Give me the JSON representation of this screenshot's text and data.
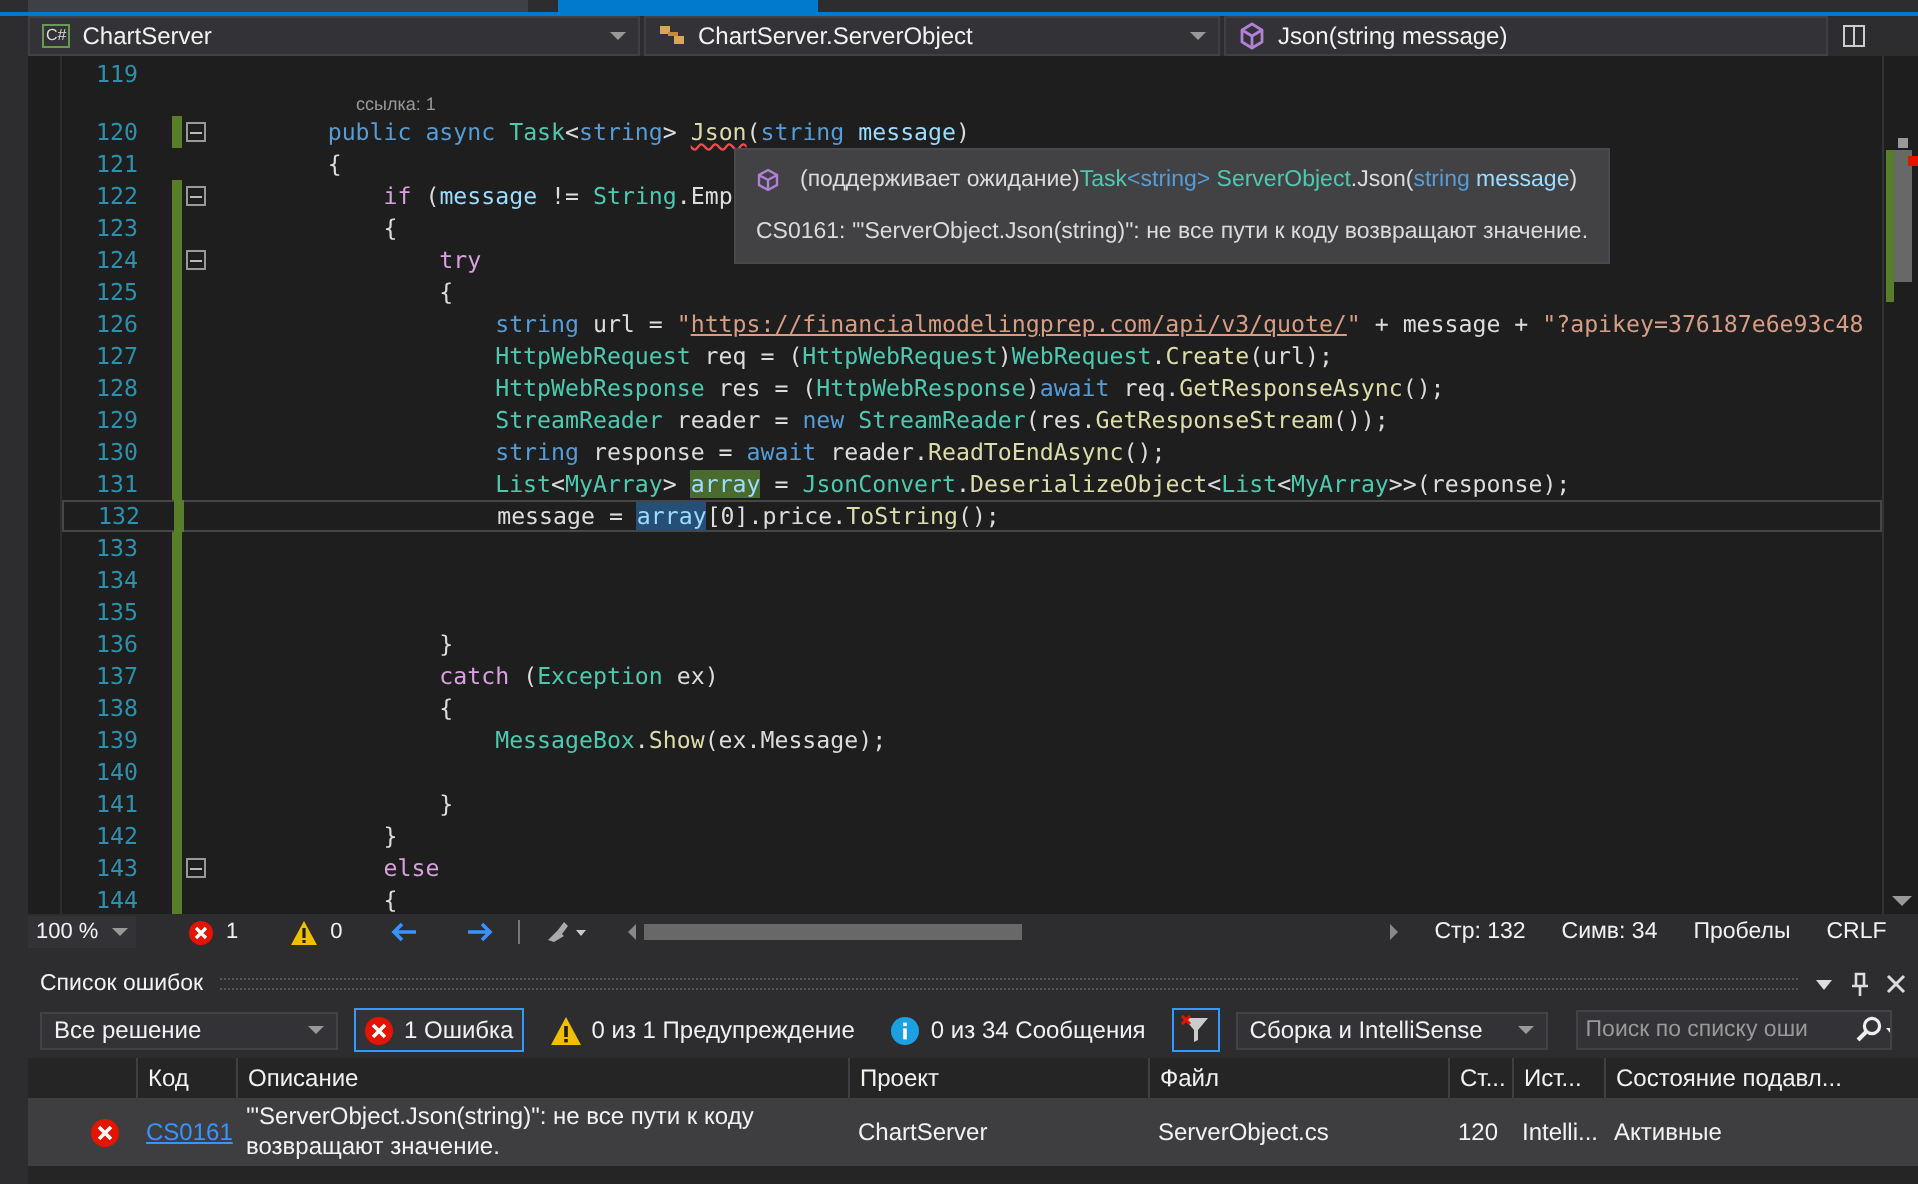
{
  "navigation": {
    "project_icon": "C#",
    "project": "ChartServer",
    "type": "ChartServer.ServerObject",
    "member": "Json(string message)"
  },
  "editor": {
    "lines": [
      {
        "kind": "code",
        "number": "119",
        "modified": false,
        "collapsible": false,
        "current": false
      },
      {
        "kind": "codelens",
        "text": "ссылка: 1"
      },
      {
        "kind": "code",
        "number": "120",
        "modified": true,
        "collapsible": true,
        "current": false,
        "tokens": [
          {
            "kind": "keyword",
            "text": "        public async "
          },
          {
            "kind": "type",
            "text": "Task"
          },
          {
            "kind": "plain",
            "text": "<"
          },
          {
            "kind": "keyword",
            "text": "string"
          },
          {
            "kind": "plain",
            "text": "> "
          },
          {
            "kind": "error-name",
            "text": "Json"
          },
          {
            "kind": "plain",
            "text": "("
          },
          {
            "kind": "keyword",
            "text": "string"
          },
          {
            "kind": "param",
            "text": " message"
          },
          {
            "kind": "plain",
            "text": ")"
          }
        ]
      },
      {
        "kind": "code",
        "number": "121",
        "modified": false,
        "collapsible": false,
        "current": false,
        "tokens": [
          {
            "kind": "plain",
            "text": "        {"
          }
        ]
      },
      {
        "kind": "code",
        "number": "122",
        "modified": true,
        "collapsible": true,
        "current": false,
        "tokens": [
          {
            "kind": "control",
            "text": "            if"
          },
          {
            "kind": "plain",
            "text": " ("
          },
          {
            "kind": "param",
            "text": "message"
          },
          {
            "kind": "plain",
            "text": " != "
          },
          {
            "kind": "type",
            "text": "String"
          },
          {
            "kind": "plain",
            "text": ".Emp"
          }
        ]
      },
      {
        "kind": "code",
        "number": "123",
        "modified": true,
        "collapsible": false,
        "current": false,
        "tokens": [
          {
            "kind": "plain",
            "text": "            {"
          }
        ]
      },
      {
        "kind": "code",
        "number": "124",
        "modified": true,
        "collapsible": true,
        "current": false,
        "tokens": [
          {
            "kind": "control",
            "text": "                try"
          }
        ]
      },
      {
        "kind": "code",
        "number": "125",
        "modified": true,
        "collapsible": false,
        "current": false,
        "tokens": [
          {
            "kind": "plain",
            "text": "                {"
          }
        ]
      },
      {
        "kind": "code",
        "number": "126",
        "modified": true,
        "collapsible": false,
        "current": false,
        "tokens": [
          {
            "kind": "keyword",
            "text": "                    string"
          },
          {
            "kind": "plain",
            "text": " url = "
          },
          {
            "kind": "string",
            "text": "\""
          },
          {
            "kind": "url",
            "text": "https://financialmodelingprep.com/api/v3/quote/"
          },
          {
            "kind": "string",
            "text": "\""
          },
          {
            "kind": "plain",
            "text": " + message + "
          },
          {
            "kind": "string",
            "text": "\"?apikey=376187e6e93c48"
          }
        ]
      },
      {
        "kind": "code",
        "number": "127",
        "modified": true,
        "collapsible": false,
        "current": false,
        "tokens": [
          {
            "kind": "type",
            "text": "                    HttpWebRequest"
          },
          {
            "kind": "plain",
            "text": " req = ("
          },
          {
            "kind": "type",
            "text": "HttpWebRequest"
          },
          {
            "kind": "plain",
            "text": ")"
          },
          {
            "kind": "type",
            "text": "WebRequest"
          },
          {
            "kind": "plain",
            "text": "."
          },
          {
            "kind": "method",
            "text": "Create"
          },
          {
            "kind": "plain",
            "text": "(url);"
          }
        ]
      },
      {
        "kind": "code",
        "number": "128",
        "modified": true,
        "collapsible": false,
        "current": false,
        "tokens": [
          {
            "kind": "type",
            "text": "                    HttpWebResponse"
          },
          {
            "kind": "plain",
            "text": " res = ("
          },
          {
            "kind": "type",
            "text": "HttpWebResponse"
          },
          {
            "kind": "plain",
            "text": ")"
          },
          {
            "kind": "keyword",
            "text": "await"
          },
          {
            "kind": "plain",
            "text": " req."
          },
          {
            "kind": "method",
            "text": "GetResponseAsync"
          },
          {
            "kind": "plain",
            "text": "();"
          }
        ]
      },
      {
        "kind": "code",
        "number": "129",
        "modified": true,
        "collapsible": false,
        "current": false,
        "tokens": [
          {
            "kind": "type",
            "text": "                    StreamReader"
          },
          {
            "kind": "plain",
            "text": " reader = "
          },
          {
            "kind": "keyword",
            "text": "new"
          },
          {
            "kind": "type",
            "text": " StreamReader"
          },
          {
            "kind": "plain",
            "text": "(res."
          },
          {
            "kind": "method",
            "text": "GetResponseStream"
          },
          {
            "kind": "plain",
            "text": "());"
          }
        ]
      },
      {
        "kind": "code",
        "number": "130",
        "modified": true,
        "collapsible": false,
        "current": false,
        "tokens": [
          {
            "kind": "keyword",
            "text": "                    string"
          },
          {
            "kind": "plain",
            "text": " response = "
          },
          {
            "kind": "keyword",
            "text": "await"
          },
          {
            "kind": "plain",
            "text": " reader."
          },
          {
            "kind": "method",
            "text": "ReadToEndAsync"
          },
          {
            "kind": "plain",
            "text": "();"
          }
        ]
      },
      {
        "kind": "code",
        "number": "131",
        "modified": true,
        "collapsible": false,
        "current": false,
        "tokens": [
          {
            "kind": "type",
            "text": "                    List"
          },
          {
            "kind": "plain",
            "text": "<"
          },
          {
            "kind": "type",
            "text": "MyArray"
          },
          {
            "kind": "plain",
            "text": "> "
          },
          {
            "kind": "ref-write",
            "text": "array"
          },
          {
            "kind": "plain",
            "text": " = "
          },
          {
            "kind": "type",
            "text": "JsonConvert"
          },
          {
            "kind": "plain",
            "text": "."
          },
          {
            "kind": "method",
            "text": "DeserializeObject"
          },
          {
            "kind": "plain",
            "text": "<"
          },
          {
            "kind": "type",
            "text": "List"
          },
          {
            "kind": "plain",
            "text": "<"
          },
          {
            "kind": "type",
            "text": "MyArray"
          },
          {
            "kind": "plain",
            "text": ">>(response);"
          }
        ]
      },
      {
        "kind": "code",
        "number": "132",
        "modified": true,
        "collapsible": false,
        "current": true,
        "tokens": [
          {
            "kind": "plain",
            "text": "                    message = "
          },
          {
            "kind": "ref-read",
            "text": "array"
          },
          {
            "kind": "plain",
            "text": "[0].price."
          },
          {
            "kind": "method",
            "text": "ToString"
          },
          {
            "kind": "plain",
            "text": "();"
          }
        ]
      },
      {
        "kind": "code",
        "number": "133",
        "modified": true,
        "collapsible": false,
        "current": false
      },
      {
        "kind": "code",
        "number": "134",
        "modified": true,
        "collapsible": false,
        "current": false
      },
      {
        "kind": "code",
        "number": "135",
        "modified": true,
        "collapsible": false,
        "current": false
      },
      {
        "kind": "code",
        "number": "136",
        "modified": true,
        "collapsible": false,
        "current": false,
        "tokens": [
          {
            "kind": "plain",
            "text": "                }"
          }
        ]
      },
      {
        "kind": "code",
        "number": "137",
        "modified": true,
        "collapsible": false,
        "current": false,
        "tokens": [
          {
            "kind": "control",
            "text": "                catch"
          },
          {
            "kind": "plain",
            "text": " ("
          },
          {
            "kind": "type",
            "text": "Exception"
          },
          {
            "kind": "plain",
            "text": " ex)"
          }
        ]
      },
      {
        "kind": "code",
        "number": "138",
        "modified": true,
        "collapsible": false,
        "current": false,
        "tokens": [
          {
            "kind": "plain",
            "text": "                {"
          }
        ]
      },
      {
        "kind": "code",
        "number": "139",
        "modified": true,
        "collapsible": false,
        "current": false,
        "tokens": [
          {
            "kind": "type",
            "text": "                    MessageBox"
          },
          {
            "kind": "plain",
            "text": "."
          },
          {
            "kind": "method",
            "text": "Show"
          },
          {
            "kind": "plain",
            "text": "(ex.Message);"
          }
        ]
      },
      {
        "kind": "code",
        "number": "140",
        "modified": true,
        "collapsible": false,
        "current": false
      },
      {
        "kind": "code",
        "number": "141",
        "modified": true,
        "collapsible": false,
        "current": false,
        "tokens": [
          {
            "kind": "plain",
            "text": "                }"
          }
        ]
      },
      {
        "kind": "code",
        "number": "142",
        "modified": true,
        "collapsible": false,
        "current": false,
        "tokens": [
          {
            "kind": "plain",
            "text": "            }"
          }
        ]
      },
      {
        "kind": "code",
        "number": "143",
        "modified": true,
        "collapsible": true,
        "current": false,
        "tokens": [
          {
            "kind": "control",
            "text": "            else"
          }
        ]
      },
      {
        "kind": "code",
        "number": "144",
        "modified": true,
        "collapsible": false,
        "current": false,
        "tokens": [
          {
            "kind": "plain",
            "text": "            {"
          }
        ]
      }
    ],
    "tooltip": {
      "prefix": "(поддерживает ожидание)",
      "signature": [
        {
          "kind": "type",
          "text": "Task"
        },
        {
          "kind": "keyword",
          "text": "<string>"
        },
        {
          "kind": "type",
          "text": " ServerObject"
        },
        {
          "kind": "plain",
          "text": ".Json("
        },
        {
          "kind": "keyword",
          "text": "string"
        },
        {
          "kind": "param",
          "text": " message"
        },
        {
          "kind": "plain",
          "text": ")"
        }
      ],
      "message": "CS0161: '\"ServerObject.Json(string)\": не все пути к коду возвращают значение."
    }
  },
  "status_bar": {
    "zoom": "100 %",
    "errors": "1",
    "warnings": "0",
    "line": "Стр: 132",
    "column": "Симв: 34",
    "indent": "Пробелы",
    "line_ending": "CRLF"
  },
  "error_list": {
    "title": "Список ошибок",
    "scope": "Все решение",
    "filters": [
      {
        "kind": "error",
        "label": "1 Ошибка",
        "selected": true
      },
      {
        "kind": "warning",
        "label": "0 из 1 Предупреждение",
        "selected": false
      },
      {
        "kind": "info",
        "label": "0 из 34 Сообщения",
        "selected": false
      }
    ],
    "build_filter": {
      "on": true
    },
    "source": "Сборка и IntelliSense",
    "search": {
      "placeholder": "Поиск по списку оши"
    },
    "columns": [
      "Код",
      "Описание",
      "Проект",
      "Файл",
      "Ст...",
      "Ист...",
      "Состояние подавл..."
    ],
    "rows": [
      {
        "kind": "error",
        "code": "CS0161",
        "description": "'\"ServerObject.Json(string)\": не все пути к коду возвращают значение.",
        "project": "ChartServer",
        "file": "ServerObject.cs",
        "line": "120",
        "tool": "Intelli...",
        "state": "Активные"
      }
    ]
  }
}
